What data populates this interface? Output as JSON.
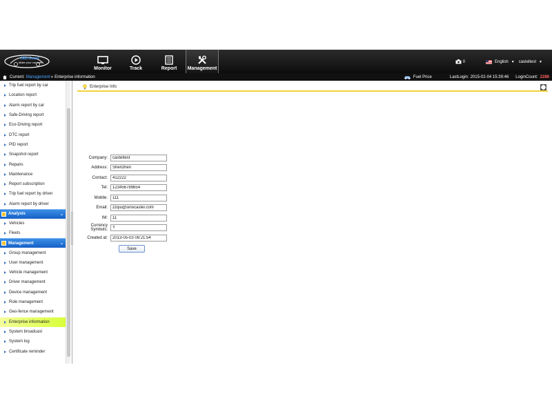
{
  "header": {
    "logo_text": "OBD-Guard",
    "logo_sub": "Make your car safe",
    "nav": [
      {
        "label": "Monitor",
        "icon": "monitor-icon"
      },
      {
        "label": "Track",
        "icon": "play-icon"
      },
      {
        "label": "Report",
        "icon": "report-icon"
      },
      {
        "label": "Management",
        "icon": "tools-icon"
      }
    ],
    "camera_count": "0",
    "language": "English",
    "user": "casteltest"
  },
  "breadcrumb": {
    "current_label": "Current:",
    "section": "Management",
    "separator": "»",
    "page": "Enterprise information",
    "fuel_price": "Fuel Price",
    "last_login_label": "LastLogin:",
    "last_login_value": "2015-02-04 15:39:46",
    "login_count_label": "LoginCount:",
    "login_count_value": "2286"
  },
  "sidebar": {
    "report_items": [
      "Trip fuel report by car",
      "Location report",
      "Alarm report by car",
      "Safe-Driving report",
      "Eco-Driving report",
      "DTC report",
      "PID report",
      "Snapshot report",
      "Repairs",
      "Maintenance",
      "Report subscription",
      "Trip fuel report by driver",
      "Alarm report by driver"
    ],
    "analysis_header": "Analysis",
    "analysis_items": [
      "Vehicles",
      "Fleets"
    ],
    "management_header": "Management",
    "management_items": [
      "Group management",
      "User management",
      "Vehicle management",
      "Driver management",
      "Device management",
      "Role management",
      "Geo-fence management",
      "Enterprise information",
      "System broadcast",
      "System log",
      "Certificate reminder"
    ],
    "selected": "Enterprise information"
  },
  "panel": {
    "title": "Enterprise Info",
    "fields": [
      {
        "label": "Company:",
        "value": "casteltest"
      },
      {
        "label": "Address:",
        "value": "Shenzhen"
      },
      {
        "label": "Contact:",
        "value": "412222"
      },
      {
        "label": "Tel:",
        "value": "123456789654"
      },
      {
        "label": "Mobile:",
        "value": "111"
      },
      {
        "label": "Email:",
        "value": "zzqiu@sinocastel.com"
      },
      {
        "label": "IM:",
        "value": "11"
      },
      {
        "label": "Currency Symbols:",
        "value": "Y"
      },
      {
        "label": "Created at:",
        "value": "2013-05-03 08:21:54"
      }
    ],
    "save_label": "Save"
  },
  "colors": {
    "header_bg": "#111111",
    "accent_blue": "#1a6fd6",
    "selected_bg": "#e4ff5a",
    "panel_underline": "#f2d23a",
    "login_count": "#ff5b5b"
  }
}
